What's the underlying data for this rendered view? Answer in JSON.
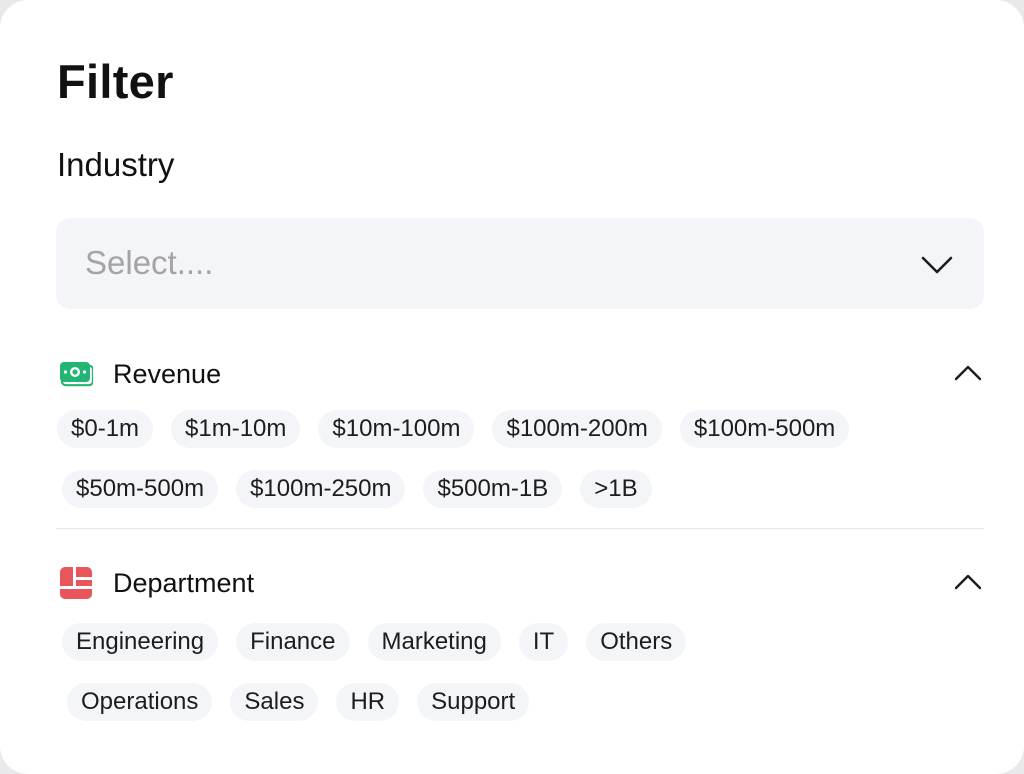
{
  "filter": {
    "title": "Filter",
    "industry": {
      "label": "Industry",
      "placeholder": "Select...."
    },
    "revenue": {
      "label": "Revenue",
      "icon": "money-icon",
      "icon_color": "#22b573",
      "expanded": true,
      "options": [
        "$0-1m",
        "$1m-10m",
        "$10m-100m",
        "$100m-200m",
        "$100m-500m",
        "$50m-500m",
        "$100m-250m",
        "$500m-1B",
        ">1B"
      ]
    },
    "department": {
      "label": "Department",
      "icon": "layout-grid-icon",
      "icon_color": "#e8555a",
      "expanded": true,
      "options": [
        "Engineering",
        "Finance",
        "Marketing",
        "IT",
        "Others",
        "Operations",
        "Sales",
        "HR",
        "Support"
      ]
    }
  }
}
